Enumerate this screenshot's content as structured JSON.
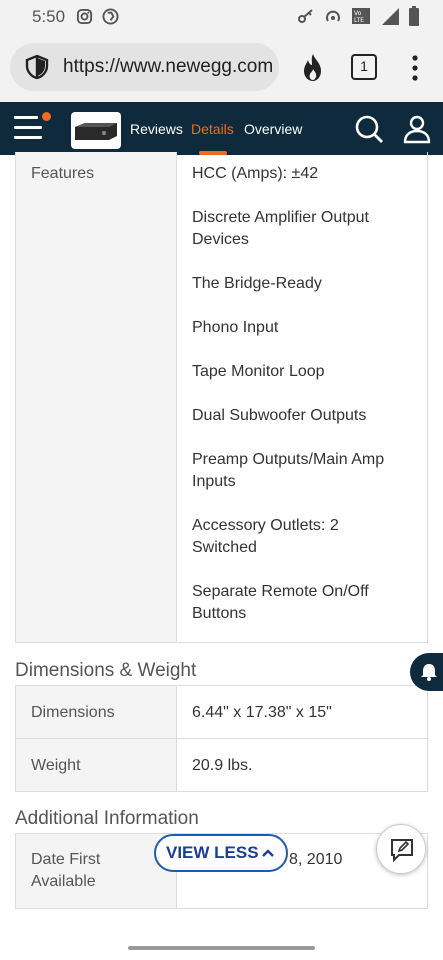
{
  "status_bar": {
    "time": "5:50"
  },
  "browser": {
    "url": "https://www.newegg.com",
    "tab_count": "1"
  },
  "nav": {
    "tabs": [
      "Reviews",
      "Details",
      "Overview"
    ],
    "active_tab": "Details"
  },
  "features": {
    "label": "Features",
    "items": [
      "HCC (Amps): ±42",
      "Discrete Amplifier Output Devices",
      "The Bridge-Ready",
      "Phono Input",
      "Tape Monitor Loop",
      "Dual Subwoofer Outputs",
      "Preamp Outputs/Main Amp Inputs",
      "Accessory Outlets: 2 Switched",
      "Separate Remote On/Off Buttons"
    ]
  },
  "dimensions_weight": {
    "title": "Dimensions & Weight",
    "rows": [
      {
        "key": "Dimensions",
        "value": "6.44\" x 17.38\" x 15\""
      },
      {
        "key": "Weight",
        "value": "20.9 lbs."
      }
    ]
  },
  "additional_info": {
    "title": "Additional Information",
    "rows": [
      {
        "key": "Date First Available",
        "value": "8, 2010"
      }
    ]
  },
  "view_less_label": "VIEW LESS",
  "colors": {
    "nav_bg": "#0e2a3c",
    "accent": "#f26a21",
    "link": "#1c3f94"
  }
}
